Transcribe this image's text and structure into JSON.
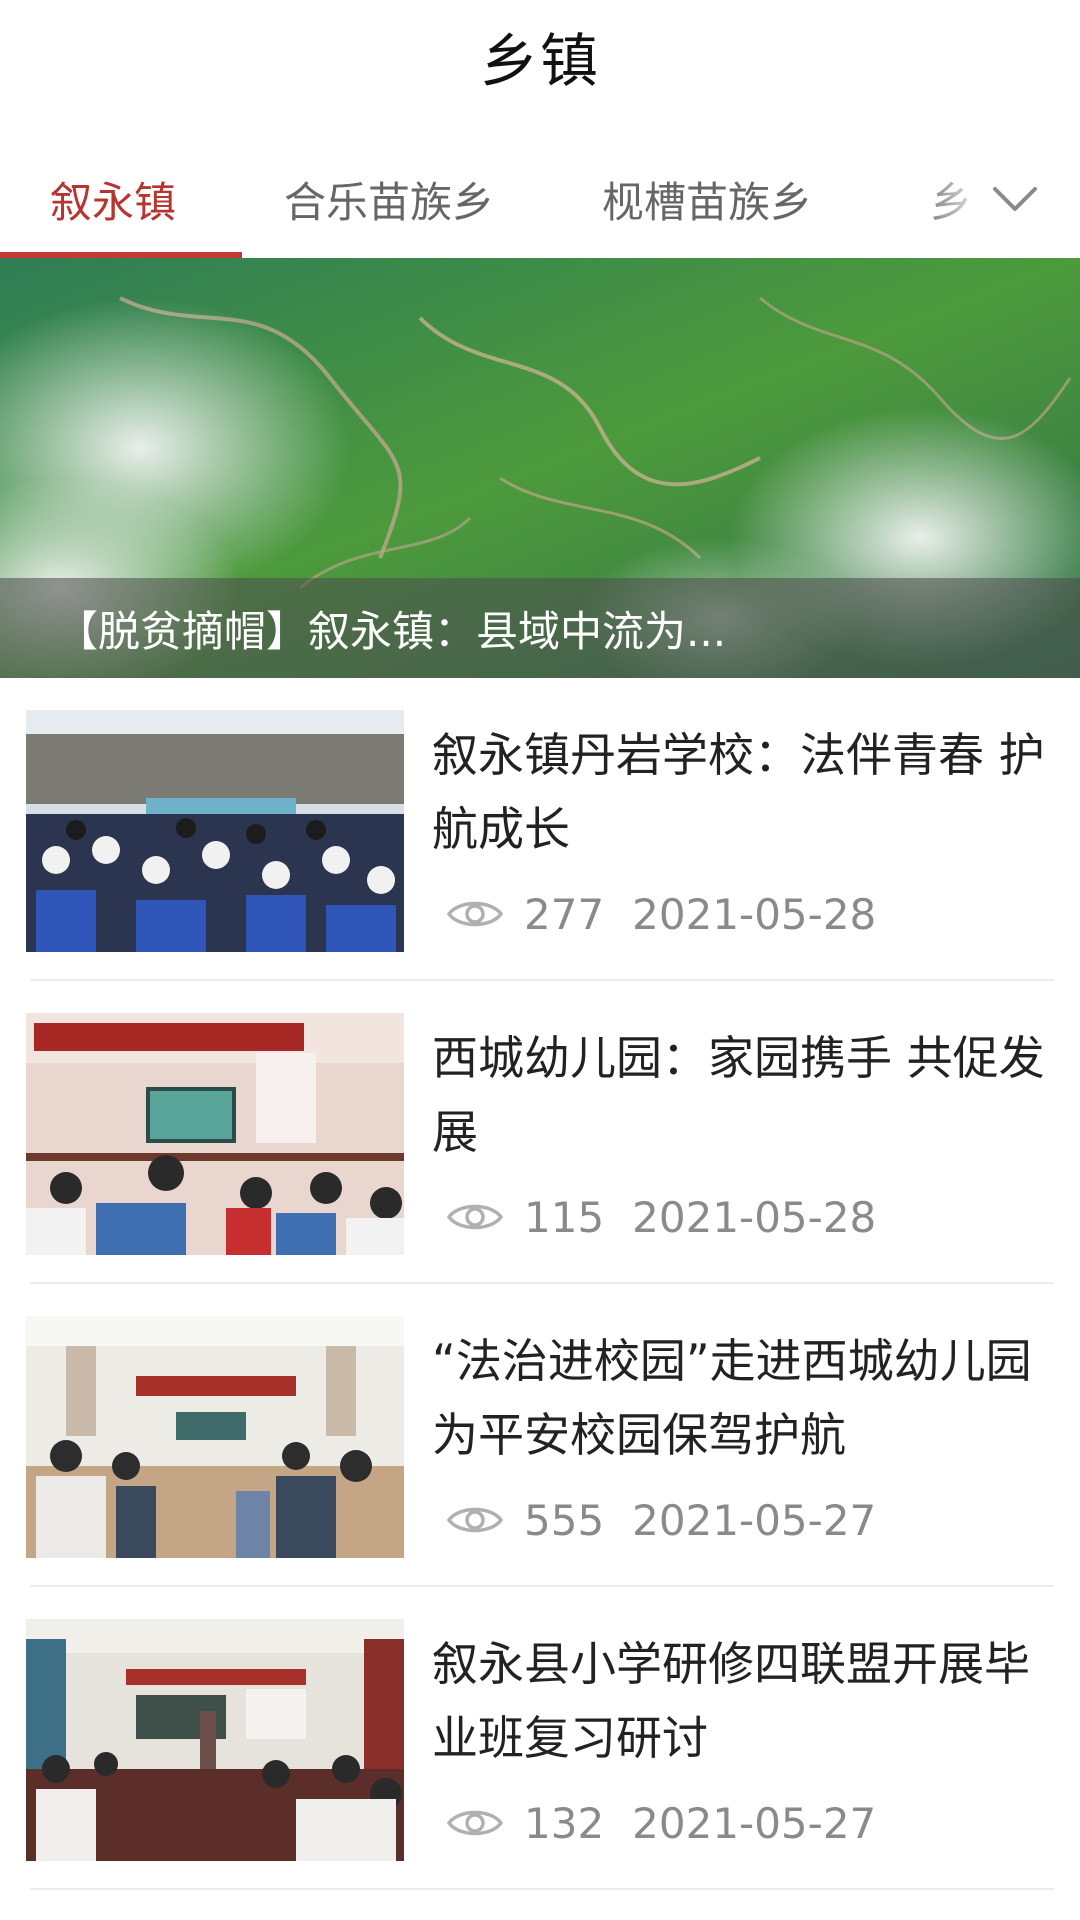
{
  "header": {
    "title": "乡镇"
  },
  "tabs": [
    {
      "label": "叙永镇",
      "active": true
    },
    {
      "label": "合乐苗族乡",
      "active": false
    },
    {
      "label": "枧槽苗族乡",
      "active": false
    },
    {
      "label": "乡",
      "active": false
    }
  ],
  "tabs_more_icon": "chevron-down-icon",
  "hero": {
    "caption": "【脱贫摘帽】叙永镇：县域中流为..."
  },
  "articles": [
    {
      "title": "叙永镇丹岩学校：法伴青春  护航成长",
      "views": "277",
      "date": "2021-05-28"
    },
    {
      "title": "西城幼儿园：家园携手 共促发展",
      "views": "115",
      "date": "2021-05-28"
    },
    {
      "title": "“法治进校园”走进西城幼儿园 为平安校园保驾护航",
      "views": "555",
      "date": "2021-05-27"
    },
    {
      "title": "叙永县小学研修四联盟开展毕业班复习研讨",
      "views": "132",
      "date": "2021-05-27"
    }
  ],
  "colors": {
    "accent": "#c33a35",
    "meta": "#8a8a8a"
  }
}
